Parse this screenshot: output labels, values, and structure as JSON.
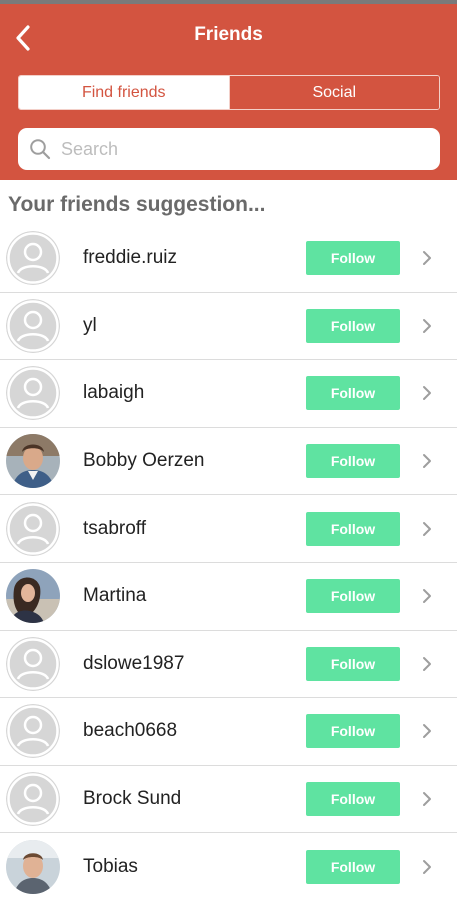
{
  "header": {
    "title": "Friends",
    "back_icon": "chevron-left-icon",
    "color": "#d35440"
  },
  "tabs": [
    {
      "label": "Find friends",
      "active": true
    },
    {
      "label": "Social",
      "active": false
    }
  ],
  "search": {
    "placeholder": "Search",
    "value": "",
    "icon": "search-icon"
  },
  "section_title": "Your friends suggestion...",
  "follow_color": "#5fe3a1",
  "friends": [
    {
      "name": "freddie.ruiz",
      "button": "Follow",
      "avatar": "default"
    },
    {
      "name": "yl",
      "button": "Follow",
      "avatar": "default"
    },
    {
      "name": "labaigh",
      "button": "Follow",
      "avatar": "default"
    },
    {
      "name": "Bobby Oerzen",
      "button": "Follow",
      "avatar": "photo-man"
    },
    {
      "name": "tsabroff",
      "button": "Follow",
      "avatar": "default"
    },
    {
      "name": "Martina",
      "button": "Follow",
      "avatar": "photo-woman"
    },
    {
      "name": "dslowe1987",
      "button": "Follow",
      "avatar": "default"
    },
    {
      "name": "beach0668",
      "button": "Follow",
      "avatar": "default"
    },
    {
      "name": "Brock Sund",
      "button": "Follow",
      "avatar": "default"
    },
    {
      "name": "Tobias",
      "button": "Follow",
      "avatar": "photo-man-2"
    }
  ]
}
